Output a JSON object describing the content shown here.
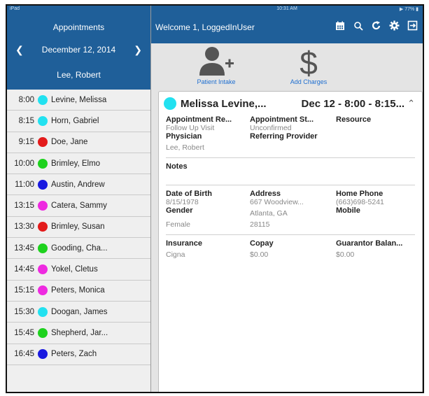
{
  "status": {
    "device": "iPad",
    "time": "10:31 AM",
    "battery": "77%"
  },
  "sidebar": {
    "title": "Appointments",
    "date": "December 12, 2014",
    "provider": "Lee, Robert",
    "appointments": [
      {
        "time": "8:00",
        "name": "Levine, Melissa",
        "color": "#22e1f0"
      },
      {
        "time": "8:15",
        "name": "Horn, Gabriel",
        "color": "#22e1f0"
      },
      {
        "time": "9:15",
        "name": "Doe, Jane",
        "color": "#e31b1b"
      },
      {
        "time": "10:00",
        "name": "Brimley, Elmo",
        "color": "#1ed21e"
      },
      {
        "time": "11:00",
        "name": "Austin, Andrew",
        "color": "#1a1ae0"
      },
      {
        "time": "13:15",
        "name": "Catera, Sammy",
        "color": "#ee2ae0"
      },
      {
        "time": "13:30",
        "name": "Brimley, Susan",
        "color": "#e31b1b"
      },
      {
        "time": "13:45",
        "name": "Gooding, Cha...",
        "color": "#1ed21e"
      },
      {
        "time": "14:45",
        "name": "Yokel, Cletus",
        "color": "#ee2ae0"
      },
      {
        "time": "15:15",
        "name": "Peters, Monica",
        "color": "#ee2ae0"
      },
      {
        "time": "15:30",
        "name": "Doogan, James",
        "color": "#22e1f0"
      },
      {
        "time": "15:45",
        "name": "Shepherd, Jar...",
        "color": "#1ed21e"
      },
      {
        "time": "16:45",
        "name": "Peters, Zach",
        "color": "#1a1ae0"
      }
    ]
  },
  "header": {
    "welcome": "Welcome 1, LoggedInUser",
    "icons": [
      "calendar-icon",
      "search-icon",
      "refresh-icon",
      "gear-icon",
      "logout-icon"
    ]
  },
  "actions": {
    "patient_intake": "Patient Intake",
    "add_charges": "Add Charges"
  },
  "detail": {
    "color": "#22e1f0",
    "patient": "Melissa Levine,...",
    "when": "Dec 12 - 8:00 - 8:15...",
    "appointment_reason_label": "Appointment Re...",
    "appointment_reason": "Follow Up Visit",
    "appointment_status_label": "Appointment St...",
    "appointment_status": "Unconfirmed",
    "resource_label": "Resource",
    "physician_label": "Physician",
    "physician": "Lee, Robert",
    "referring_label": "Referring Provider",
    "notes_label": "Notes",
    "dob_label": "Date of Birth",
    "dob": "8/15/1978",
    "address_label": "Address",
    "address_line1": "667 Woodview...",
    "address_line2": "Atlanta, GA",
    "address_line3": "28115",
    "home_phone_label": "Home Phone",
    "home_phone": "(663)698-5241",
    "gender_label": "Gender",
    "gender": "Female",
    "mobile_label": "Mobile",
    "insurance_label": "Insurance",
    "insurance": "Cigna",
    "copay_label": "Copay",
    "copay": "$0.00",
    "guarantor_label": "Guarantor Balan...",
    "guarantor": "$0.00"
  }
}
